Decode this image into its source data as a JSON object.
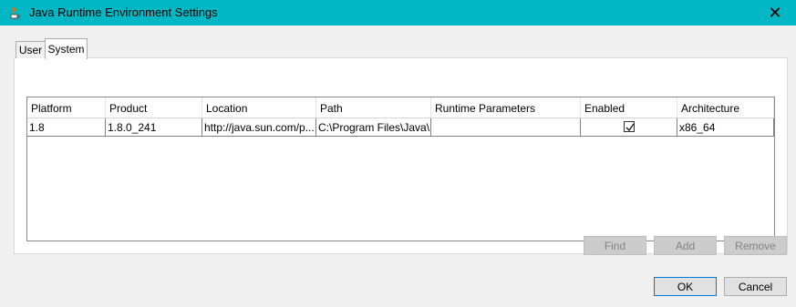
{
  "window": {
    "title": "Java Runtime Environment Settings",
    "close_glyph": "✕",
    "app_icon": "java-icon"
  },
  "tabs": [
    {
      "label": "User",
      "selected": false
    },
    {
      "label": "System",
      "selected": true
    }
  ],
  "table": {
    "columns": [
      "Platform",
      "Product",
      "Location",
      "Path",
      "Runtime Parameters",
      "Enabled",
      "Architecture"
    ],
    "rows": [
      {
        "platform": "1.8",
        "product": "1.8.0_241",
        "location": "http://java.sun.com/p...",
        "path": "C:\\Program Files\\Java\\...",
        "runtime_parameters": "",
        "enabled": true,
        "architecture": "x86_64"
      }
    ]
  },
  "buttons": {
    "find": "Find",
    "add": "Add",
    "remove": "Remove",
    "ok": "OK",
    "cancel": "Cancel"
  },
  "colors": {
    "titlebar": "#00b7c3",
    "accent": "#0078d7"
  }
}
